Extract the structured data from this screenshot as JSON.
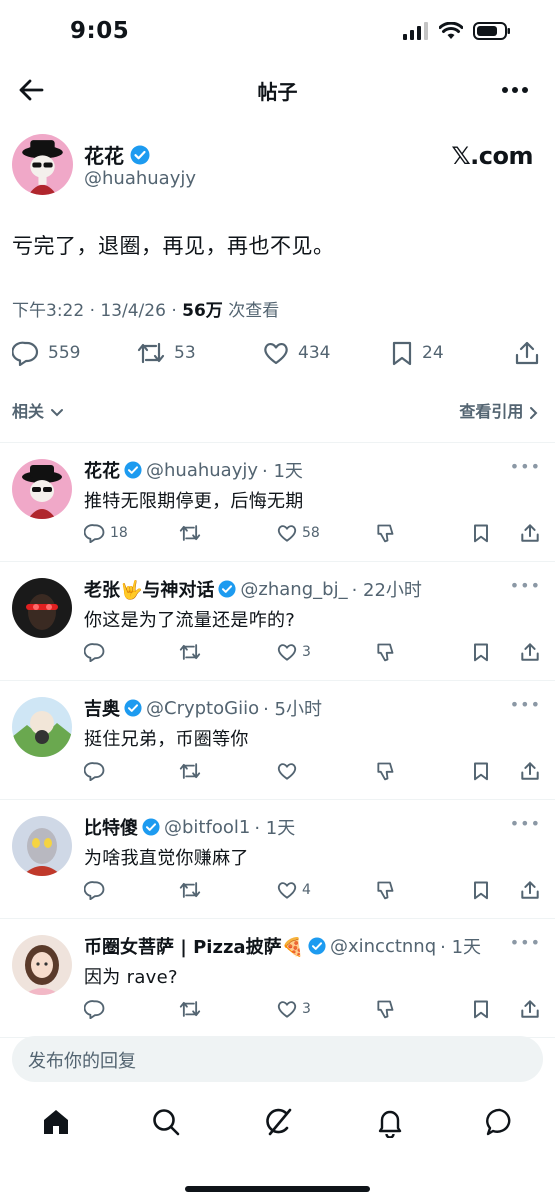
{
  "status": {
    "time": "9:05"
  },
  "nav": {
    "title": "帖子"
  },
  "brand": {
    "label": "𝕏.com"
  },
  "main_post": {
    "name": "花花",
    "handle": "@huahuayjy",
    "text": "亏完了，退圈，再见，再也不见。",
    "time_date": "下午3:22 · 13/4/26 · ",
    "views": "56万",
    "views_label": " 次查看",
    "stats": {
      "replies": "559",
      "reposts": "53",
      "likes": "434",
      "bookmarks": "24"
    }
  },
  "related": {
    "label": "相关",
    "quotes_link": "查看引用"
  },
  "replies": [
    {
      "name": "花花",
      "handle": "@huahuayjy",
      "time": "· 1天",
      "text": "推特无限期停更，后悔无期",
      "replies": "18",
      "likes": "58"
    },
    {
      "name": "老张🤟与神对话",
      "handle": "@zhang_bj_",
      "time": "· 22小时",
      "text": "你这是为了流量还是咋的?",
      "replies": "",
      "likes": "3"
    },
    {
      "name": "吉奥",
      "handle": "@CryptoGiio",
      "time": "· 5小时",
      "text": "挺住兄弟，币圈等你",
      "replies": "",
      "likes": ""
    },
    {
      "name": "比特傻",
      "handle": "@bitfool1",
      "time": "· 1天",
      "text": "为啥我直觉你赚麻了",
      "replies": "",
      "likes": "4"
    },
    {
      "name": "币圈女菩萨 | Pizza披萨🍕",
      "handle": "@xincctnnq",
      "time": "· 1天",
      "text": "因为 rave?",
      "replies": "",
      "likes": "3"
    }
  ],
  "composer": {
    "placeholder": "发布你的回复"
  },
  "colors": {
    "verified": "#1d9bf0",
    "secondary": "#536471",
    "text": "#0f1419"
  }
}
